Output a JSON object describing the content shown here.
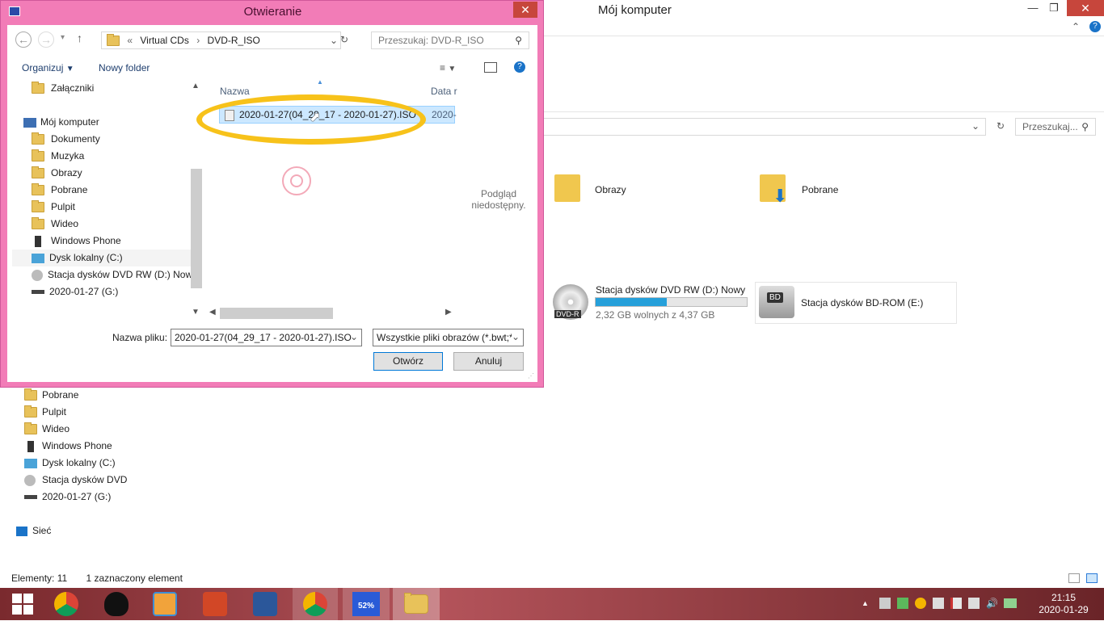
{
  "background_window": {
    "title": "Mój komputer",
    "search_placeholder": "Przeszukaj...",
    "folders": [
      "Obrazy",
      "Pobrane"
    ],
    "drive_dvd": {
      "label": "Stacja dysków DVD RW (D:) Nowy",
      "free": "2,32 GB wolnych z 4,37 GB",
      "used_fraction": 0.47,
      "badge": "DVD-R"
    },
    "drive_bd": {
      "label": "Stacja dysków BD-ROM (E:)",
      "badge": "BD"
    },
    "tree": [
      "Pobrane",
      "Pulpit",
      "Wideo",
      "Windows Phone",
      "Dysk lokalny (C:)",
      "Stacja dysków DVD",
      "2020-01-27 (G:)"
    ],
    "network": "Sieć",
    "status_count": "Elementy: 11",
    "status_selected": "1 zaznaczony element"
  },
  "dialog": {
    "title": "Otwieranie",
    "breadcrumb": [
      "«",
      "Virtual CDs",
      "›",
      "DVD-R_ISO"
    ],
    "search_placeholder": "Przeszukaj: DVD-R_ISO",
    "toolbar": {
      "organize": "Organizuj",
      "new_folder": "Nowy folder"
    },
    "tree": [
      "Załączniki",
      "Mój komputer",
      "Dokumenty",
      "Muzyka",
      "Obrazy",
      "Pobrane",
      "Pulpit",
      "Wideo",
      "Windows Phone",
      "Dysk lokalny (C:)",
      "Stacja dysków DVD RW (D:) Nowy",
      "2020-01-27 (G:)"
    ],
    "columns": {
      "name": "Nazwa",
      "date": "Data r"
    },
    "file": {
      "name": "2020-01-27(04_29_17 - 2020-01-27).ISO",
      "date": "2020-"
    },
    "preview": {
      "line1": "Podgląd",
      "line2": "niedostępny."
    },
    "filename_label": "Nazwa pliku:",
    "filename_value": "2020-01-27(04_29_17 - 2020-01-27).ISO",
    "filter_value": "Wszystkie pliki obrazów (*.bwt;*",
    "open_button": "Otwórz",
    "cancel_button": "Anuluj"
  },
  "taskbar": {
    "time": "21:15",
    "date": "2020-01-29",
    "ime_badge": "52%"
  },
  "colors": {
    "dialog_frame": "#f27cb7",
    "highlight": "#f7c21a",
    "selection": "#cce8ff",
    "progress": "#26a0da"
  }
}
